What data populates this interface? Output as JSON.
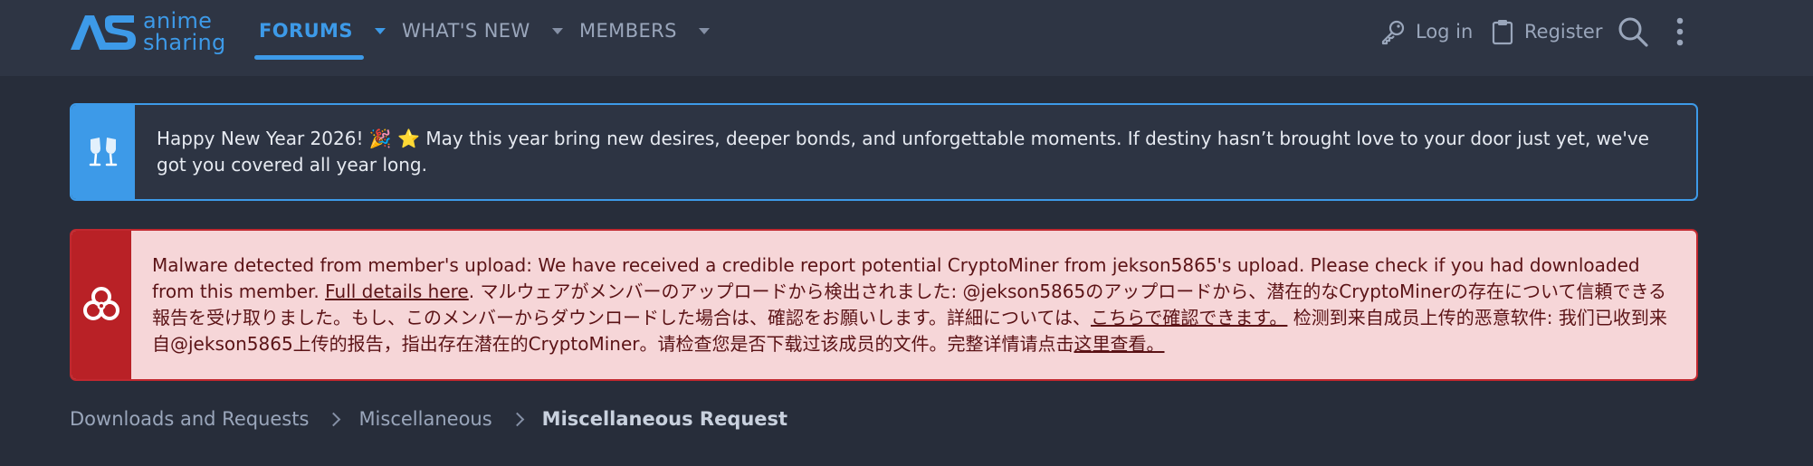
{
  "header": {
    "logo": {
      "mark": "AS",
      "word1": "anime",
      "word2": "sharing"
    },
    "nav": [
      {
        "label": "FORUMS",
        "active": true
      },
      {
        "label": "WHAT'S NEW",
        "active": false
      },
      {
        "label": "MEMBERS",
        "active": false
      }
    ],
    "login_label": "Log in",
    "register_label": "Register",
    "icons": {
      "login": "key-icon",
      "register": "clipboard-icon",
      "search": "search-icon",
      "more": "more-vertical-icon"
    }
  },
  "notices": {
    "new_year": {
      "icon": "cheers-icon",
      "text": "Happy New Year 2026! 🎉 ⭐ May this year bring new desires, deeper bonds, and unforgettable moments. If destiny hasn’t brought love to your door just yet, we've got you covered all year long."
    },
    "malware": {
      "icon": "biohazard-icon",
      "intro": "Malware detected from member's upload: We have received a credible report potential CryptoMiner from jekson5865's upload. Please check if you had downloaded from this member. ",
      "link1": "Full details here",
      "jp": ". マルウェアがメンバーのアップロードから検出されました: @jekson5865のアップロードから、潜在的なCryptoMinerの存在について信頼できる報告を受け取りました。もし、このメンバーからダウンロードした場合は、確認をお願いします。詳細については、",
      "link2": "こちらで確認できます。",
      "cn": " 检测到来自成员上传的恶意软件: 我们已收到来自@jekson5865上传的报告，指出存在潜在的CryptoMiner。请检查您是否下载过该成员的文件。完整详情请点击",
      "link3": "这里查看。"
    }
  },
  "breadcrumb": {
    "items": [
      "Downloads and Requests",
      "Miscellaneous"
    ],
    "current": "Miscellaneous Request"
  },
  "colors": {
    "accent": "#3d9ae8",
    "danger": "#b92126",
    "danger_bg": "#f6d6d8",
    "page_bg": "#272d3a",
    "header_bg": "#2e3544"
  }
}
